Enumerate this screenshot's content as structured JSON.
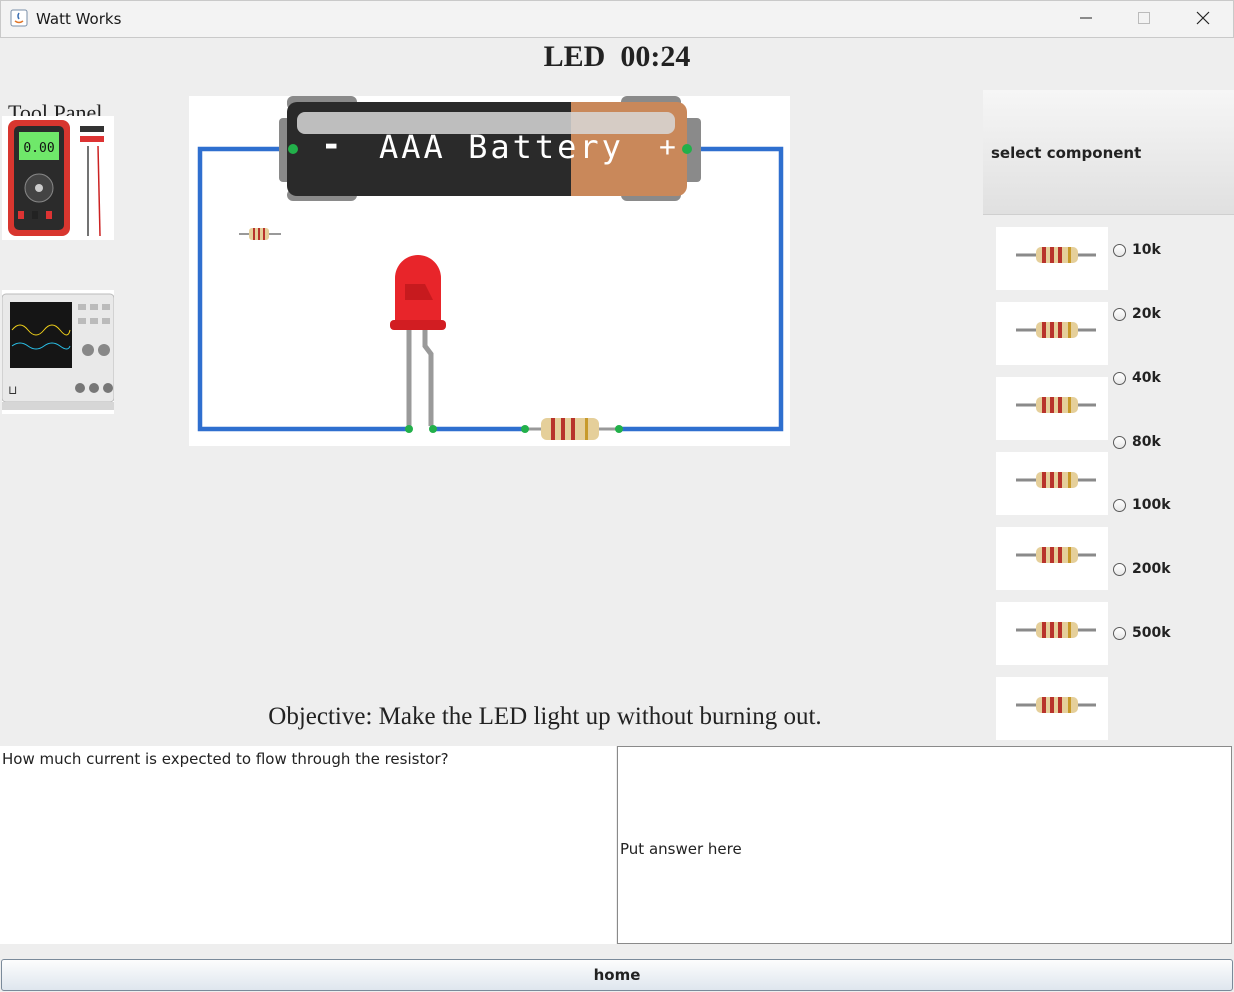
{
  "window": {
    "title": "Watt Works"
  },
  "level": {
    "title": "LED  00:24"
  },
  "tool_panel": {
    "label": "Tool Panel",
    "multimeter_display": "0.00"
  },
  "canvas": {
    "battery_label": "AAA Battery",
    "minus": "-",
    "plus": "+"
  },
  "objective": "Objective: Make the LED light up without burning out.",
  "component_panel": {
    "header": "select component",
    "options": [
      "10k",
      "20k",
      "40k",
      "80k",
      "100k",
      "200k",
      "500k"
    ]
  },
  "question": "How much current is expected to flow through the resistor?",
  "answer": {
    "placeholder": "Put answer here"
  },
  "home_button": "home",
  "colors": {
    "wire": "#2f6fcf",
    "led": "#e8252a",
    "battery_body": "#2a2a2a",
    "battery_cap": "#c9885a"
  },
  "icons": [
    "java-app-icon",
    "minimize-icon",
    "maximize-icon",
    "close-icon",
    "multimeter-icon",
    "oscilloscope-icon",
    "resistor-icon",
    "led-icon",
    "battery-icon"
  ]
}
